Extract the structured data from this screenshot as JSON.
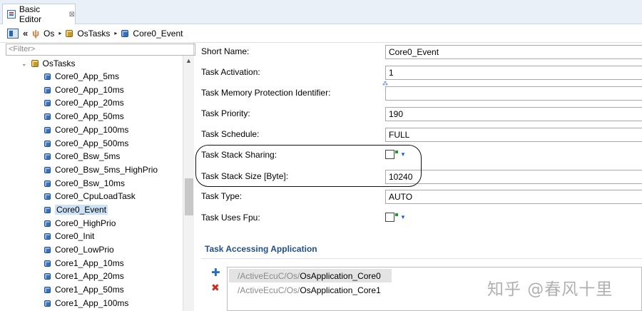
{
  "tab": {
    "title": "Basic Editor",
    "close": "⊠"
  },
  "breadcrumb": {
    "back": "«",
    "items": [
      "Os",
      "OsTasks",
      "Core0_Event"
    ],
    "separator": "▸"
  },
  "filter": {
    "placeholder": "<Filter>"
  },
  "tree": {
    "root": "OsTasks",
    "items": [
      "Core0_App_5ms",
      "Core0_App_10ms",
      "Core0_App_20ms",
      "Core0_App_50ms",
      "Core0_App_100ms",
      "Core0_App_500ms",
      "Core0_Bsw_5ms",
      "Core0_Bsw_5ms_HighPrio",
      "Core0_Bsw_10ms",
      "Core0_CpuLoadTask",
      "Core0_Event",
      "Core0_HighPrio",
      "Core0_Init",
      "Core0_LowPrio",
      "Core1_App_10ms",
      "Core1_App_20ms",
      "Core1_App_50ms",
      "Core1_App_100ms"
    ],
    "selected": "Core0_Event"
  },
  "form": {
    "short_name": {
      "label": "Short Name:",
      "value": "Core0_Event"
    },
    "task_activation": {
      "label": "Task Activation:",
      "value": "1"
    },
    "task_mpi": {
      "label": "Task Memory Protection Identifier:",
      "value": ""
    },
    "task_priority": {
      "label": "Task Priority:",
      "value": "190"
    },
    "task_schedule": {
      "label": "Task Schedule:",
      "value": "FULL"
    },
    "task_stack_sharing": {
      "label": "Task Stack Sharing:"
    },
    "task_stack_size": {
      "label": "Task Stack Size [Byte]:",
      "value": "10240"
    },
    "task_type": {
      "label": "Task Type:",
      "value": "AUTO"
    },
    "task_uses_fpu": {
      "label": "Task Uses Fpu:"
    }
  },
  "accessing": {
    "title": "Task Accessing Application",
    "apps": [
      {
        "path": "/ActiveEcuC/Os/",
        "name": "OsApplication_Core0"
      },
      {
        "path": "/ActiveEcuC/Os/",
        "name": "OsApplication_Core1"
      }
    ]
  },
  "watermark": "知乎 @春风十里",
  "colors": {
    "accent": "#1f4f8c",
    "selection": "#cce2f7",
    "tab_bg": "#eaf0f8"
  }
}
